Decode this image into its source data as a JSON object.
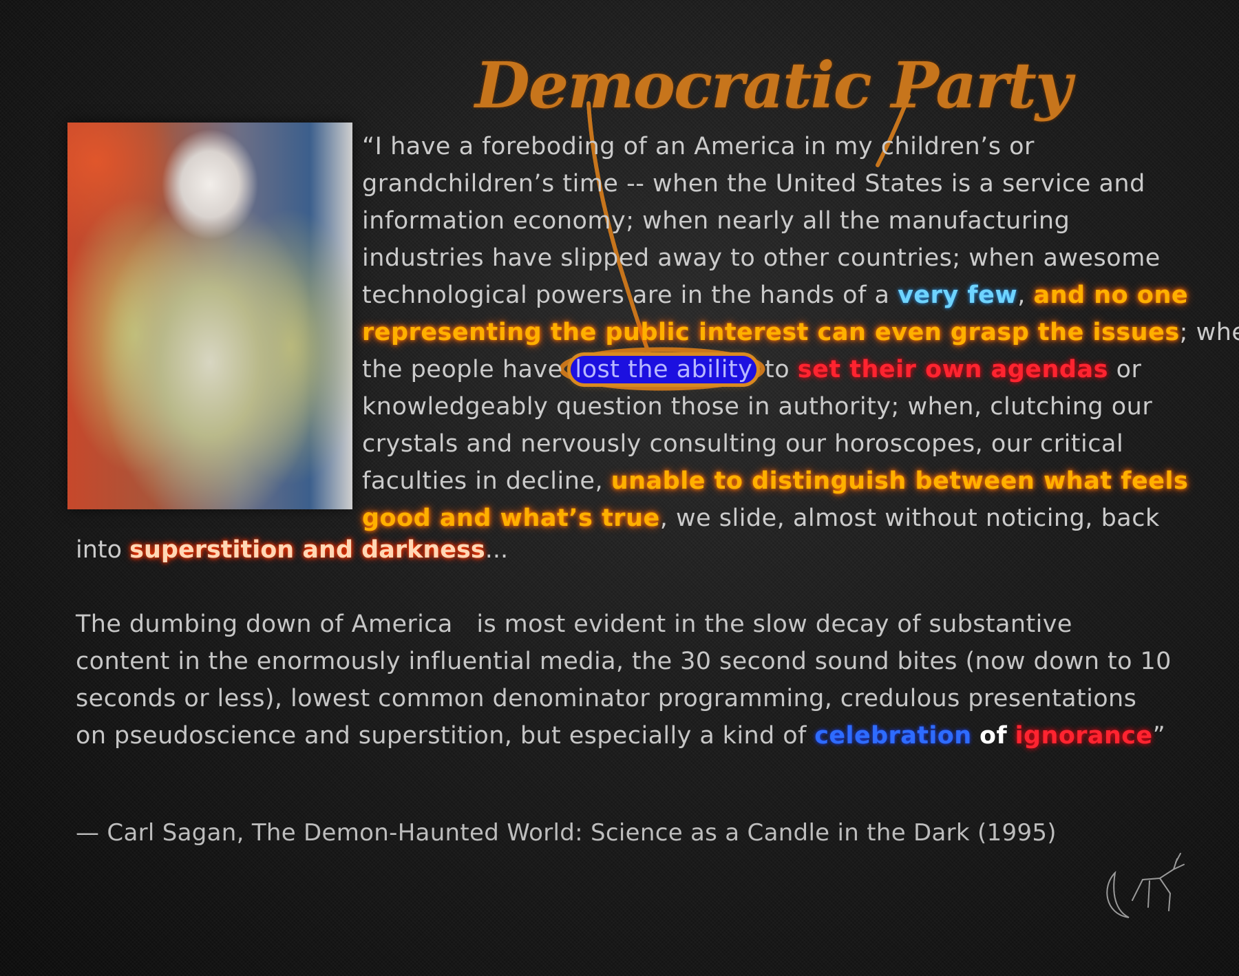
{
  "annotation": {
    "text": "Democratic Party"
  },
  "quote": {
    "lines": [
      [
        "“I have a foreboding of an America in my children’s or"
      ],
      [
        "grandchildren’s time -- when the United States is a service and"
      ],
      [
        "information economy; when nearly all the manufacturing"
      ],
      [
        "industries have slipped away to other countries; when awesome"
      ],
      [
        "technological powers are in the hands of a ",
        "very few",
        ", ",
        "and no one"
      ],
      [
        "representing the public interest can even grasp the issues",
        "; when"
      ],
      [
        "the people have ",
        "lost the ability",
        " to ",
        "set their own agendas",
        " or"
      ],
      [
        "knowledgeably question those in authority; when, clutching our"
      ],
      [
        "crystals and nervously consulting our horoscopes, our critical"
      ],
      [
        "faculties in decline, ",
        "unable to distinguish between what feels"
      ],
      [
        "good and what’s true",
        ", we slide, almost without noticing, back"
      ]
    ],
    "last_line": [
      "into ",
      "superstition and darkness",
      "..."
    ]
  },
  "para2": {
    "lines": [
      [
        "The dumbing down of America   is most evident in the slow decay of substantive"
      ],
      [
        "content in the enormously influential media, the 30 second sound bites (now down to 10"
      ],
      [
        "seconds or less), lowest common denominator programming, credulous presentations"
      ],
      [
        "on pseudoscience and superstition, but especially a kind of ",
        "celebration",
        " ",
        "of",
        " ",
        "ignorance",
        "”"
      ]
    ]
  },
  "citation": "— Carl Sagan, The Demon-Haunted World: Science as a Candle in the Dark (1995)",
  "colors": {
    "orange_highlight": "#ffb000",
    "cyan_highlight": "#6fd4ff",
    "red_highlight": "#ff2430",
    "blue_box": "#1c10e0",
    "annotation": "#c7751c"
  },
  "icons": {
    "signature": "moon-and-deer-signature-icon"
  }
}
